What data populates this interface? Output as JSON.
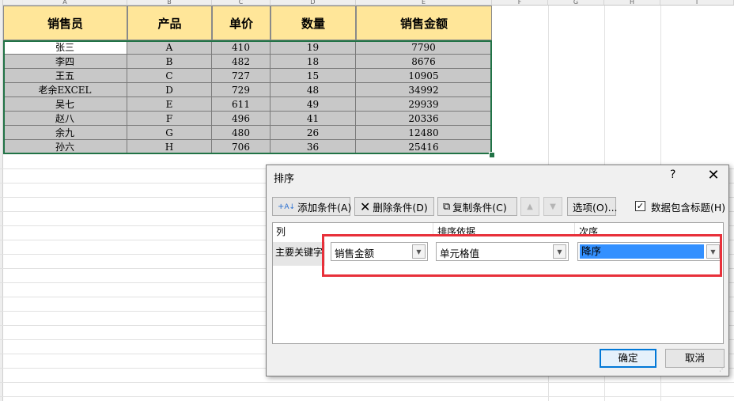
{
  "sheet": {
    "col_letters": [
      "A",
      "B",
      "C",
      "D",
      "E",
      "F",
      "G",
      "H",
      "I"
    ],
    "headers": [
      "销售员",
      "产品",
      "单价",
      "数量",
      "销售金额"
    ],
    "rows": [
      [
        "张三",
        "A",
        "410",
        "19",
        "7790"
      ],
      [
        "李四",
        "B",
        "482",
        "18",
        "8676"
      ],
      [
        "王五",
        "C",
        "727",
        "15",
        "10905"
      ],
      [
        "老余EXCEL",
        "D",
        "729",
        "48",
        "34992"
      ],
      [
        "吴七",
        "E",
        "611",
        "49",
        "29939"
      ],
      [
        "赵八",
        "F",
        "496",
        "41",
        "20336"
      ],
      [
        "余九",
        "G",
        "480",
        "26",
        "12480"
      ],
      [
        "孙六",
        "H",
        "706",
        "36",
        "25416"
      ]
    ],
    "header_color": "#ffe699",
    "row_color": "#c8c8c8",
    "selection_color": "#217346"
  },
  "dialog": {
    "title": "排序",
    "help": "?",
    "close": "✕",
    "add_btn": "添加条件(A)",
    "del_btn": "删除条件(D)",
    "copy_btn": "复制条件(C)",
    "up_arrow": "▲",
    "down_arrow": "▼",
    "options_btn": "选项(O)...",
    "header_checkbox_checked": "✓",
    "header_checkbox_label": "数据包含标题(H)",
    "col_header": "列",
    "sort_on_header": "排序依据",
    "order_header": "次序",
    "row_label": "主要关键字",
    "column_value": "销售金额",
    "sort_on_value": "单元格值",
    "order_value": "降序",
    "ok_btn": "确定",
    "cancel_btn": "取消",
    "highlight_color": "#e8303a"
  }
}
